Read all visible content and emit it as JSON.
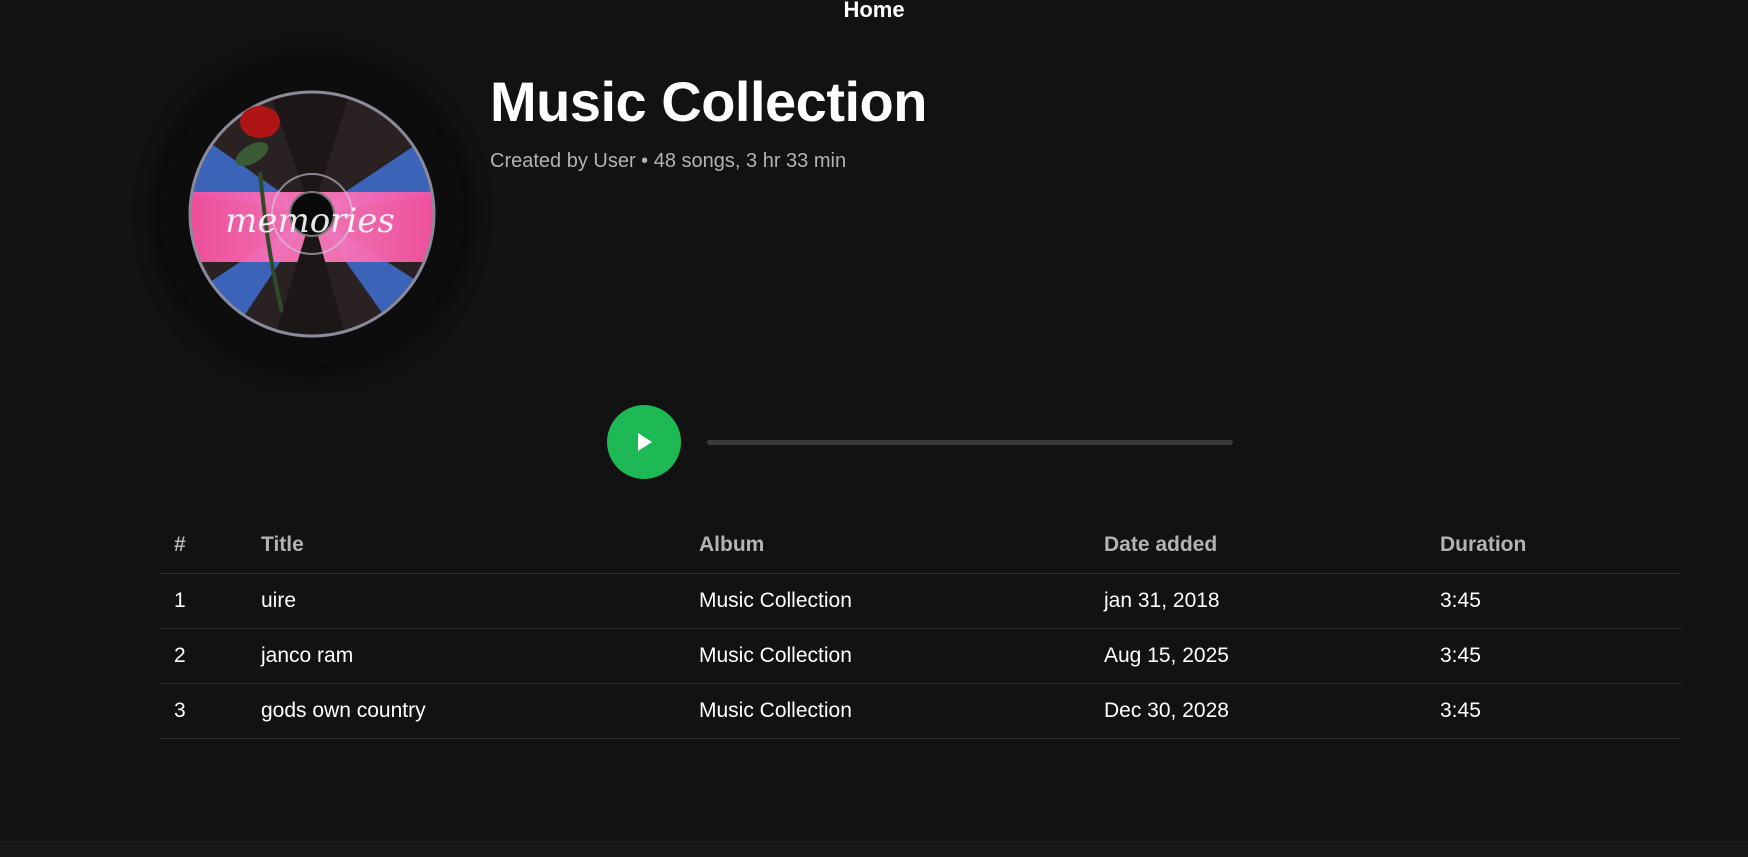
{
  "nav": {
    "home_label": "Home"
  },
  "playlist": {
    "title": "Music Collection",
    "meta": "Created by User • 48 songs, 3 hr 33 min",
    "cover_text": "memories"
  },
  "player": {
    "progress_fraction": 0.0,
    "accent_color": "#1db954"
  },
  "table": {
    "headers": {
      "num": "#",
      "title": "Title",
      "album": "Album",
      "date_added": "Date added",
      "duration": "Duration"
    },
    "rows": [
      {
        "num": "1",
        "title": "uire",
        "album": "Music Collection",
        "date_added": "jan 31, 2018",
        "duration": "3:45"
      },
      {
        "num": "2",
        "title": "janco ram",
        "album": "Music Collection",
        "date_added": "Aug 15, 2025",
        "duration": "3:45"
      },
      {
        "num": "3",
        "title": "gods own country",
        "album": "Music Collection",
        "date_added": "Dec 30, 2028",
        "duration": "3:45"
      }
    ]
  },
  "colors": {
    "background": "#121212",
    "text_muted": "#b3b3b3",
    "divider": "#2e2e2e"
  }
}
